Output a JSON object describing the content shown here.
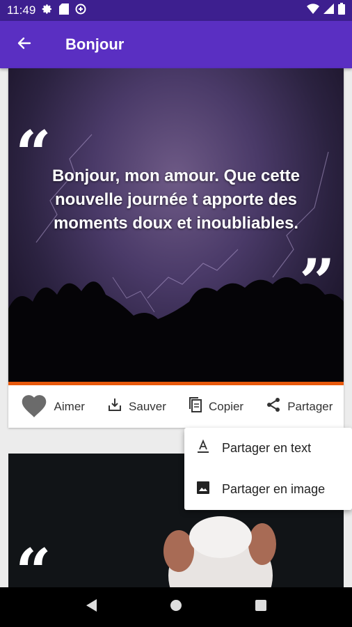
{
  "status_bar": {
    "time": "11:49",
    "icons_left": [
      "settings-icon",
      "sd-card-icon",
      "data-saver-icon"
    ],
    "icons_right": [
      "wifi-icon",
      "signal-icon",
      "battery-icon"
    ]
  },
  "app_bar": {
    "title": "Bonjour",
    "back_icon": "arrow-left-icon"
  },
  "card1": {
    "quote": "Bonjour, mon amour. Que cette nouvelle journée t apporte des moments doux et inoubliables.",
    "accent_color": "#e8590c",
    "actions": [
      {
        "label": "Aimer",
        "icon": "heart-icon"
      },
      {
        "label": "Sauver",
        "icon": "download-icon"
      },
      {
        "label": "Copier",
        "icon": "copy-icon"
      },
      {
        "label": "Partager",
        "icon": "share-icon"
      }
    ]
  },
  "share_menu": {
    "items": [
      {
        "label": "Partager en text",
        "icon": "text-format-icon"
      },
      {
        "label": "Partager en image",
        "icon": "image-icon"
      }
    ]
  },
  "colors": {
    "status_bar": "#3d1f8f",
    "app_bar": "#5a2fc2"
  }
}
